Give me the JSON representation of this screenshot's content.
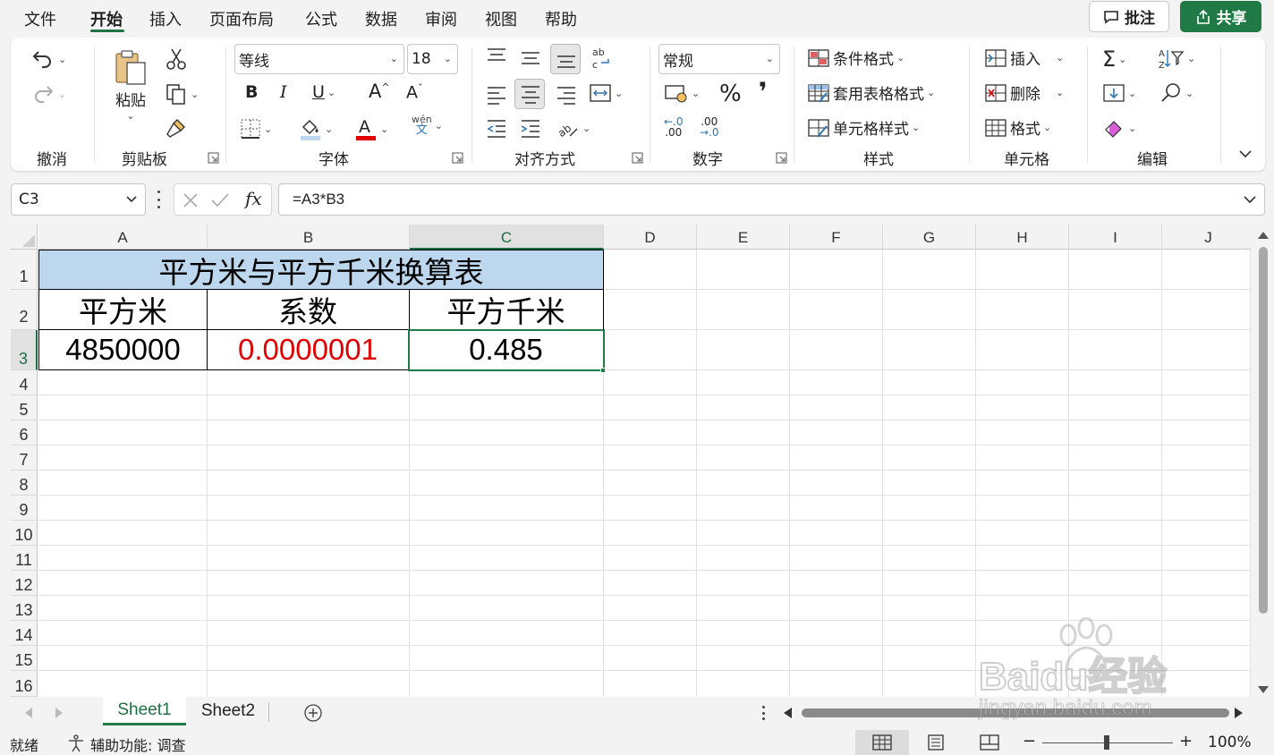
{
  "menu": {
    "tabs": [
      "文件",
      "开始",
      "插入",
      "页面布局",
      "公式",
      "数据",
      "审阅",
      "视图",
      "帮助"
    ],
    "active_tab": "开始",
    "comment_label": "批注",
    "share_label": "共享"
  },
  "ribbon": {
    "undo_group": "撤消",
    "clipboard": {
      "label": "剪贴板",
      "paste": "粘贴"
    },
    "font": {
      "label": "字体",
      "name": "等线",
      "size": "18",
      "phonetic": "wén",
      "phonetic_char": "文"
    },
    "alignment": {
      "label": "对齐方式"
    },
    "number": {
      "label": "数字",
      "format": "常规",
      "percent": "%",
      "comma": "❜",
      "dec_inc": ".00",
      "dec_dec": ".0"
    },
    "styles": {
      "label": "样式",
      "conditional": "条件格式",
      "table_format": "套用表格格式",
      "cell_styles": "单元格样式"
    },
    "cells": {
      "label": "单元格",
      "insert": "插入",
      "delete": "删除",
      "format": "格式"
    },
    "editing": {
      "label": "编辑"
    }
  },
  "formula_bar": {
    "name_box": "C3",
    "formula": "=A3*B3",
    "fx": "fx"
  },
  "sheet": {
    "columns": [
      "A",
      "B",
      "C",
      "D",
      "E",
      "F",
      "G",
      "H",
      "I",
      "J"
    ],
    "selected_column": "C",
    "rows": [
      "1",
      "2",
      "3",
      "4",
      "5",
      "6",
      "7",
      "8",
      "9",
      "10",
      "11",
      "12",
      "13",
      "14",
      "15",
      "16"
    ],
    "selected_row": "3",
    "title": "平方米与平方千米换算表",
    "headers": [
      "平方米",
      "系数",
      "平方千米"
    ],
    "values": [
      "4850000",
      "0.0000001",
      "0.485"
    ],
    "title_fill": "#bdd7ee",
    "red_text": "#e00000"
  },
  "sheet_tabs": {
    "tabs": [
      "Sheet1",
      "Sheet2"
    ],
    "active": "Sheet1"
  },
  "status": {
    "ready": "就绪",
    "accessibility": "辅助功能: 调查",
    "zoom": "100%"
  },
  "watermark": {
    "brand": "Baidu经验",
    "url": "jingyan.baidu.com"
  }
}
